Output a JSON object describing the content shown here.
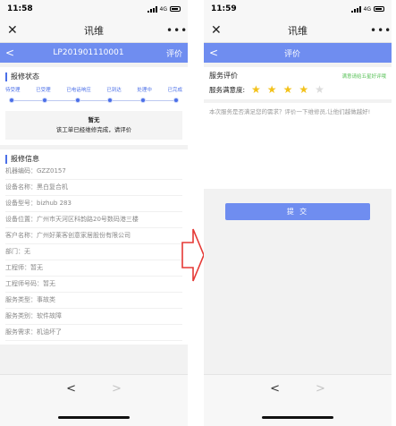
{
  "colors": {
    "accent": "#6f8df0",
    "star_on": "#f3c21b",
    "arrow": "#e53935",
    "hint": "#5ac25a"
  },
  "left": {
    "status": {
      "time": "11:58",
      "net": "4G"
    },
    "title": "讯维",
    "order_no": "LP201901110001",
    "action": "评价",
    "progress": {
      "title": "报修状态",
      "steps": [
        "待受理",
        "已受理",
        "已电话响应",
        "已到达",
        "处理中",
        "已完成"
      ],
      "notice_title": "暂无",
      "notice_body": "该工单已经维修完成，请评价"
    },
    "info": {
      "title": "报修信息",
      "rows": [
        "机器编码：GZZ0157",
        "设备名称：黑白复合机",
        "设备型号：bizhub 283",
        "设备位置：广州市天河区科韵路20号数码港三楼",
        "客户名称：广州好莱客创意家居股份有限公司",
        "部门：无",
        "工程师：暂无",
        "工程师号码：暂无",
        "服务类型：事故类",
        "服务类别：软件故障",
        "服务需求：机油坏了"
      ]
    },
    "nav": {
      "back": "<",
      "fwd": ">"
    }
  },
  "right": {
    "status": {
      "time": "11:59",
      "net": "4G"
    },
    "title": "讯维",
    "page_title": "评价",
    "rating": {
      "title": "服务评价",
      "hint": "满意请给五星好评哦",
      "label": "服务满意度:",
      "value": 4,
      "max": 5
    },
    "comment_placeholder": "本次服务是否满足您的需求？评价一下维修员,让他们越做越好!",
    "submit": "提 交",
    "nav": {
      "back": "<",
      "fwd": ">"
    }
  }
}
